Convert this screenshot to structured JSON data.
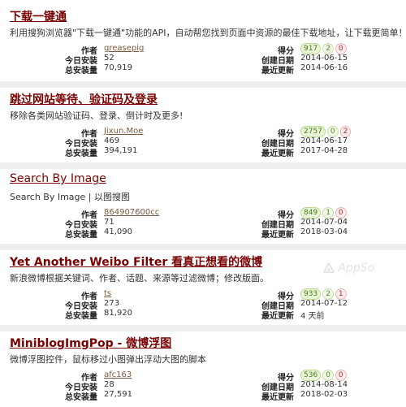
{
  "labels": {
    "author": "作者",
    "daily": "今日安装",
    "total": "总安装量",
    "score": "得分",
    "created": "创建日期",
    "updated": "最近更新"
  },
  "watermark": "AppSo",
  "scripts": [
    {
      "title": "下载一键通",
      "description": "利用搜狗浏览器\"下载一键通\"功能的API，自动帮您找到页面中资源的最佳下载地址，让下载更简单！",
      "author": "greasepig",
      "daily": "52",
      "total": "70,919",
      "score_total": "917",
      "score_good": "2",
      "score_bad": "0",
      "created": "2014-06-15",
      "updated": "2014-06-16"
    },
    {
      "title": "跳过网站等待、验证码及登录",
      "description": "移除各类网站验证码、登录、倒计时及更多!",
      "author": "Jixun.Moe",
      "daily": "469",
      "total": "394,191",
      "score_total": "2757",
      "score_good": "0",
      "score_bad": "2",
      "created": "2014-06-17",
      "updated": "2017-04-28"
    },
    {
      "title": "Search By Image",
      "description": "Search By Image | 以图搜图",
      "author": "864907600cc",
      "daily": "71",
      "total": "41,090",
      "score_total": "849",
      "score_good": "1",
      "score_bad": "0",
      "created": "2014-07-04",
      "updated": "2018-03-04"
    },
    {
      "title": "Yet Another Weibo Filter 看真正想看的微博",
      "description": "新浪微博根据关键词、作者、话题、来源等过滤微博；修改版面。",
      "author": "ts",
      "daily": "273",
      "total": "81,920",
      "score_total": "933",
      "score_good": "2",
      "score_bad": "1",
      "created": "2014-07-12",
      "updated": "4 天前"
    },
    {
      "title": "MiniblogImgPop - 微博浮图",
      "description": "微博浮图控件，鼠标移过小图弹出浮动大图的脚本",
      "author": "afc163",
      "daily": "28",
      "total": "27,591",
      "score_total": "536",
      "score_good": "0",
      "score_bad": "0",
      "created": "2014-08-14",
      "updated": "2018-02-03"
    }
  ]
}
